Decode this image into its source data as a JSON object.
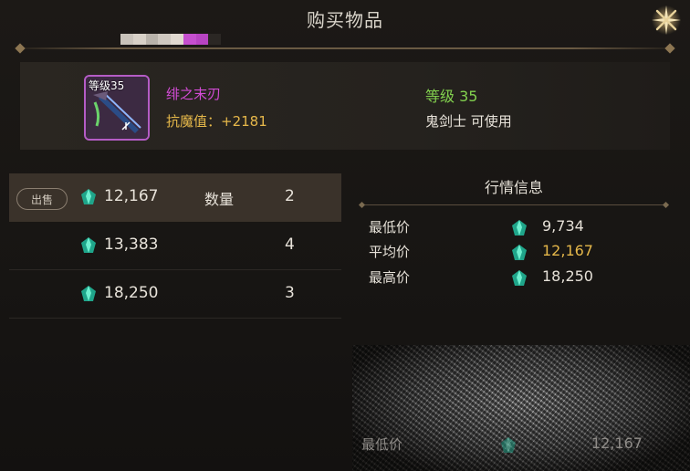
{
  "window": {
    "title": "购买物品"
  },
  "title_strip_colors": [
    "#c9c3bb",
    "#d8d1c8",
    "#b9b3ab",
    "#cfc8c0",
    "#e1d9d0",
    "#c64fcf",
    "#b844c2",
    "#2b2724"
  ],
  "item": {
    "level_tag": "等级35",
    "name": "绯之末刃",
    "stat_text": "抗魔值：+2181",
    "required_level": "等级 35",
    "class_text": "鬼剑士 可使用",
    "icon": "sword-icon",
    "rarity_color": "#d34bd6"
  },
  "listings": [
    {
      "badge": "出售",
      "price": "12,167",
      "qty_label": "数量",
      "qty": "2"
    },
    {
      "badge": "",
      "price": "13,383",
      "qty_label": "",
      "qty": "4"
    },
    {
      "badge": "",
      "price": "18,250",
      "qty_label": "",
      "qty": "3"
    }
  ],
  "market": {
    "title": "行情信息",
    "rows": [
      {
        "label": "最低价",
        "value": "9,734"
      },
      {
        "label": "平均价",
        "value": "12,167"
      },
      {
        "label": "最高价",
        "value": "18,250"
      }
    ]
  },
  "overlay_row": {
    "label": "最低价",
    "value": "12,167"
  },
  "currency_icon": "emerald-gem-icon",
  "colors": {
    "accent_gold": "#e6b84a",
    "level_green": "#82d04e",
    "epic_purple": "#d34bd6"
  }
}
